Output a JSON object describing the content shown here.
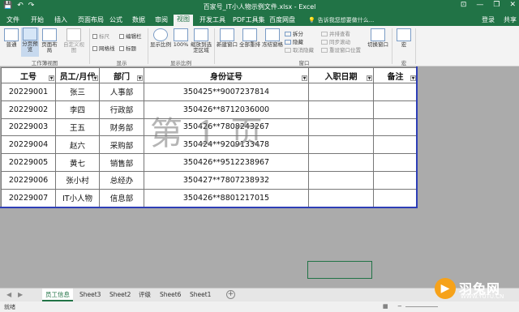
{
  "title_bar": {
    "window_title": "百家号_IT小人物示例文件.xlsx - Excel",
    "qat": [
      "💾",
      "↶",
      "↷"
    ],
    "controls": [
      "⊡",
      "—",
      "❐",
      "✕"
    ]
  },
  "ribbon_tabs": [
    "文件",
    "开始",
    "插入",
    "页面布局",
    "公式",
    "数据",
    "审阅",
    "视图",
    "开发工具",
    "PDF工具集",
    "百度网盘"
  ],
  "active_tab": "视图",
  "tell_me": "告诉我您想要做什么...",
  "login_label": "登录",
  "share_label": "共享",
  "ribbon": {
    "workbook_views": {
      "normal": "普通",
      "page_break": "分页预览",
      "page_layout": "页面布局",
      "custom": "自定义视图",
      "group_label": "工作簿视图"
    },
    "show": {
      "ruler": "标尺",
      "edit_bar": "编辑栏",
      "gridlines": "网格线",
      "headings": "标题",
      "group_label": "显示"
    },
    "zoom": {
      "zoom": "显示比例",
      "hundred": "100%",
      "to_selection": "缩放到选定区域",
      "group_label": "显示比例"
    },
    "window": {
      "new_window": "新建窗口",
      "arrange_all": "全部重排",
      "freeze": "冻结窗格",
      "split": "拆分",
      "hide": "隐藏",
      "unhide": "取消隐藏",
      "side_by_side": "并排查看",
      "sync_scroll": "同步滚动",
      "reset_position": "重设窗口位置",
      "switch": "切换窗口",
      "group_label": "窗口"
    },
    "macro": {
      "macros": "宏",
      "group_label": "宏"
    }
  },
  "table": {
    "headers": [
      "工号",
      "员工/月代",
      "部门",
      "身份证号",
      "入职日期",
      "备注"
    ],
    "rows": [
      [
        "20229001",
        "张三",
        "人事部",
        "350425**9007237814",
        "",
        ""
      ],
      [
        "20229002",
        "李四",
        "行政部",
        "350426**8712036000",
        "",
        ""
      ],
      [
        "20229003",
        "王五",
        "财务部",
        "350426**7808243267",
        "",
        ""
      ],
      [
        "20229004",
        "赵六",
        "采购部",
        "350424**9209133478",
        "",
        ""
      ],
      [
        "20229005",
        "黄七",
        "销售部",
        "350426**9512238967",
        "",
        ""
      ],
      [
        "20229006",
        "张小村",
        "总经办",
        "350427**7807238932",
        "",
        ""
      ],
      [
        "20229007",
        "IT小人物",
        "信息部",
        "350426**8801217015",
        "",
        ""
      ]
    ]
  },
  "page_watermark": "第 1 页",
  "sheet_tabs": [
    "员工信息",
    "Sheet3",
    "Sheet2",
    "评级",
    "Sheet6",
    "Sheet1"
  ],
  "active_sheet": "员工信息",
  "status": {
    "ready": "就绪",
    "zoom": "−"
  },
  "logo": {
    "mark": "▶",
    "name": "羽兔网",
    "url": "WWW.YUTU.CN"
  }
}
